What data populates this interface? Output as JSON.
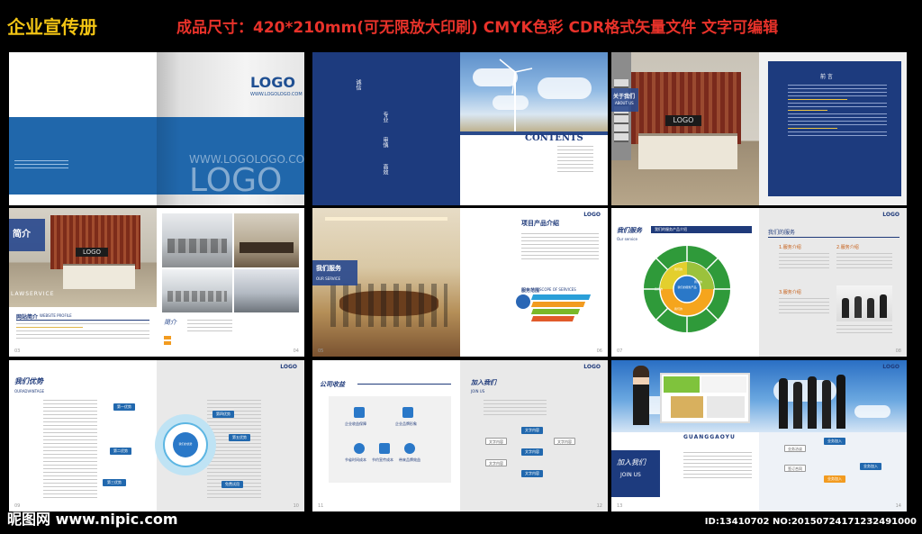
{
  "header": {
    "title": "企业宣传册",
    "spec": "成品尺寸：420*210mm(可无限放大印刷)  CMYK色彩  CDR格式矢量文件  文字可编辑"
  },
  "cover": {
    "logo": "LOGO",
    "url": "WWW.LOGOLOGO.COM",
    "big_url": "WWW.LOGOLOGO.COM",
    "big_logo": "LOGO"
  },
  "contents": {
    "words": [
      "诚信",
      "专业",
      "审慎",
      "高效"
    ],
    "title": "CONTENTS"
  },
  "about_us": {
    "cn": "关于我们",
    "en": "ABOUT US",
    "logo": "LOGO",
    "preface": "前  言"
  },
  "intro": {
    "cn": "简介",
    "en": "LAWSERVICE",
    "logo": "LOGO",
    "subtitle": "网站简介",
    "subtitle_en": "WEBSITE PROFILE",
    "page_left": "03",
    "page_right": "04"
  },
  "service": {
    "cn": "我们服务",
    "en": "OUR SERVICE",
    "logo": "LOGO",
    "project": "项目产品介绍",
    "scope": "服务范围",
    "scope_en": "SCOPE OF SERVICES",
    "page_left": "05",
    "page_right": "06"
  },
  "our_service": {
    "cn": "我们服务",
    "en": "Our service",
    "bar": "我们的服务产品介绍",
    "logo": "LOGO",
    "right_title": "我们的服务",
    "items": [
      "1.服务介绍",
      "2.服务介绍",
      "3.服务介绍"
    ],
    "wheel_center": "我们的服务产品",
    "wheel_labels": [
      "我们的",
      "我们的",
      "我们的",
      "我们的"
    ],
    "page_left": "07",
    "page_right": "08"
  },
  "advantage": {
    "cn": "我们优势",
    "en": "OURADVANTAGE",
    "logo": "LOGO",
    "center": "我们的优势",
    "boxes": [
      "第一优势",
      "第二优势",
      "第三优势",
      "第四优势",
      "第五优势",
      "免费试用"
    ],
    "page_left": "09",
    "page_right": "10"
  },
  "benefits": {
    "cn": "公司收益",
    "logo": "LOGO",
    "join_cn": "加入我们",
    "join_en": "JOIN US",
    "icons": [
      "企业收益保障",
      "企业品牌形象",
      "节省时间成本",
      "节约宣传成本",
      "带来品牌效益",
      "实力的证明"
    ],
    "flow": [
      "文字内容",
      "文字内容",
      "文字内容",
      "文字内容",
      "文字内容",
      "文字内容"
    ],
    "page_left": "11",
    "page_right": "12"
  },
  "join": {
    "brand": "GUANGGAOYU",
    "cn": "加入我们",
    "en": "JOIN US",
    "logo": "LOGO",
    "flow": [
      "业务洽谈",
      "签订合同",
      "业务加入",
      "业务加入",
      "业务加入"
    ],
    "page_left": "13",
    "page_right": "14"
  },
  "footer": {
    "watermark": "昵图网 www.nipic.com",
    "id": "ID:13410702 NO:20150724171232491000"
  }
}
